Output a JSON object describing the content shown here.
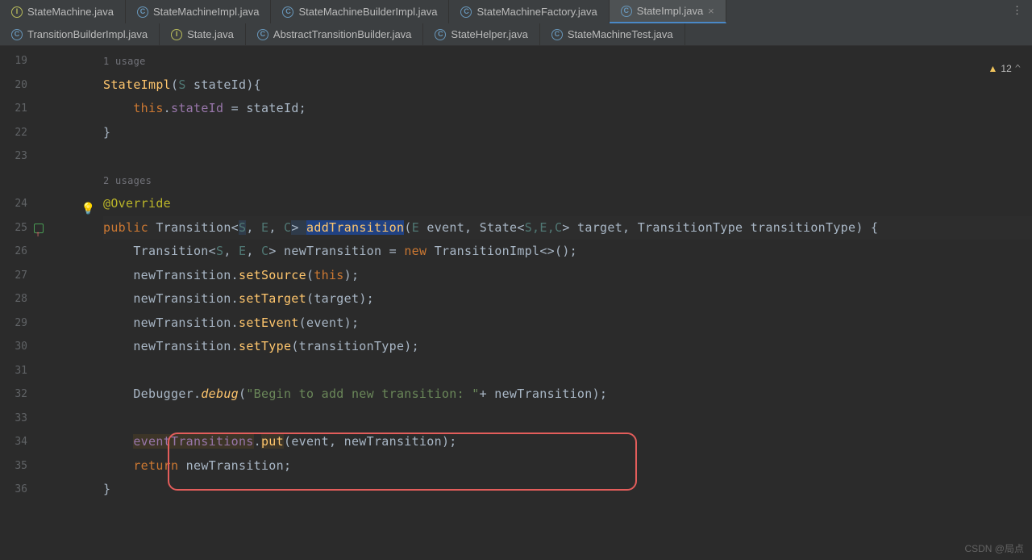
{
  "tabsRow1": [
    {
      "label": "StateMachine.java",
      "iconKind": "interface",
      "selected": false
    },
    {
      "label": "StateMachineImpl.java",
      "iconKind": "class",
      "selected": false
    },
    {
      "label": "StateMachineBuilderImpl.java",
      "iconKind": "class",
      "selected": false
    },
    {
      "label": "StateMachineFactory.java",
      "iconKind": "class",
      "selected": false
    },
    {
      "label": "StateImpl.java",
      "iconKind": "class",
      "selected": true
    }
  ],
  "tabsRow2": [
    {
      "label": "TransitionBuilderImpl.java",
      "iconKind": "class"
    },
    {
      "label": "State.java",
      "iconKind": "interface"
    },
    {
      "label": "AbstractTransitionBuilder.java",
      "iconKind": "class"
    },
    {
      "label": "StateHelper.java",
      "iconKind": "class"
    },
    {
      "label": "StateMachineTest.java",
      "iconKind": "class"
    }
  ],
  "tabMoreGlyph": "⋮",
  "tabCloseGlyph": "×",
  "iconLetter": {
    "class": "C",
    "interface": "I"
  },
  "warnings": {
    "count": "12",
    "chevron": "^"
  },
  "gutter": [
    "19",
    "20",
    "21",
    "22",
    "23",
    "",
    "24",
    "25",
    "26",
    "27",
    "28",
    "29",
    "30",
    "31",
    "32",
    "33",
    "34",
    "35",
    "36"
  ],
  "usages1": "1 usage",
  "usages2": "2 usages",
  "code": {
    "l20_ctor": "StateImpl",
    "l20_gen": "S",
    "l20_param": "stateId",
    "l21_this": "this",
    "l21_field": "stateId",
    "l21_rhs": "stateId",
    "l24_anno": "@Override",
    "l25_kw": "public",
    "l25_type": "Transition",
    "l25_g1": "S",
    "l25_g2": "E",
    "l25_g3": "C",
    "l25_method": "addTransition",
    "l25_p1t": "E",
    "l25_p1": "event",
    "l25_p2t": "State",
    "l25_p2g": "S,E,C",
    "l25_p2": "target",
    "l25_p3t": "TransitionType",
    "l25_p3": "transitionType",
    "l26_type": "Transition",
    "l26_g1": "S",
    "l26_g2": "E",
    "l26_g3": "C",
    "l26_var": "newTransition",
    "l26_new": "new",
    "l26_impl": "TransitionImpl",
    "l27_call": "newTransition",
    "l27_m": "setSource",
    "l27_arg": "this",
    "l28_call": "newTransition",
    "l28_m": "setTarget",
    "l28_arg": "target",
    "l29_call": "newTransition",
    "l29_m": "setEvent",
    "l29_arg": "event",
    "l30_call": "newTransition",
    "l30_m": "setType",
    "l30_arg": "transitionType",
    "l32_cls": "Debugger",
    "l32_m": "debug",
    "l32_str": "\"Begin to add new transition: \"",
    "l32_rhs": "newTransition",
    "l34_field": "eventTransitions",
    "l34_m": "put",
    "l34_a1": "event",
    "l34_a2": "newTransition",
    "l35_kw": "return",
    "l35_val": "newTransition"
  },
  "watermark": "CSDN @局点"
}
